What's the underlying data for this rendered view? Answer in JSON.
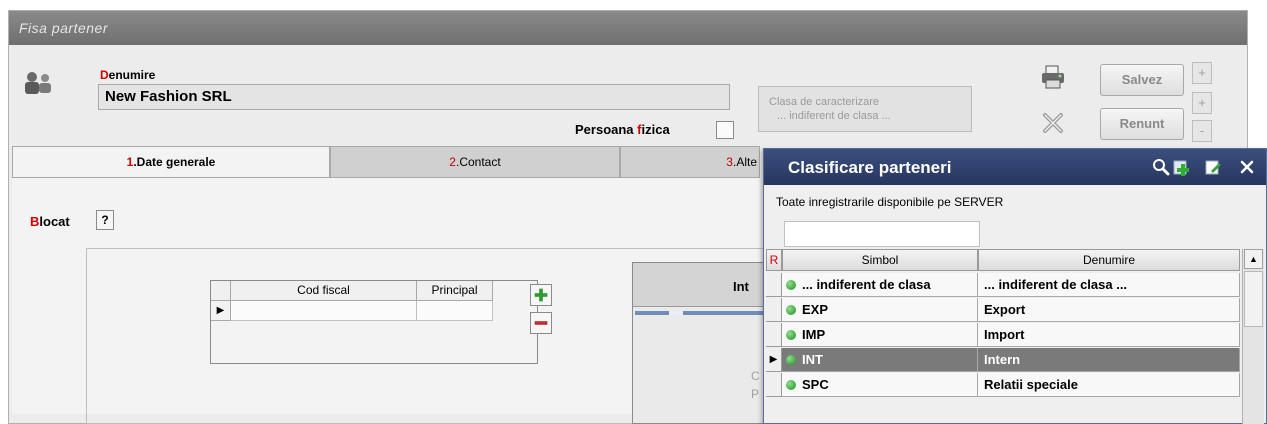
{
  "window": {
    "title": "Fisa partener"
  },
  "header": {
    "denumire_accent": "D",
    "denumire_rest": "enumire",
    "denumire_value": "New Fashion SRL",
    "pf_prefix": "Persoana ",
    "pf_accent": "f",
    "pf_suffix": "izica",
    "clasa_line1": "Clasa de caracterizare",
    "clasa_line2": "... indiferent de clasa ..."
  },
  "actions": {
    "save": "Salvez",
    "cancel": "Renunt",
    "nav_up": "+",
    "nav_mid": "+",
    "nav_down": "-"
  },
  "tabs": [
    {
      "accent": "1",
      "label": ".Date generale"
    },
    {
      "accent": "2",
      "label": ".Contact"
    },
    {
      "accent": "3",
      "label": ".Alte"
    }
  ],
  "general": {
    "blocat_accent": "B",
    "blocat_rest": "locat",
    "blocat_btn": "?",
    "grid_headers": [
      "Cod fiscal",
      "Principal"
    ],
    "row_indicator": "▶",
    "inner_title": "Int",
    "inner_t1": "C",
    "inner_t2": "P"
  },
  "popup": {
    "title": "Clasificare parteneri",
    "subtitle": "Toate inregistrarile disponibile pe SERVER",
    "search_value": "",
    "r_marker": "R",
    "columns": [
      "Simbol",
      "Denumire"
    ],
    "selected_indicator": "▶",
    "scroll_up": "▲",
    "rows": [
      {
        "simbol": "... indiferent de clasa",
        "denumire": "... indiferent de clasa ..."
      },
      {
        "simbol": "EXP",
        "denumire": "Export"
      },
      {
        "simbol": "IMP",
        "denumire": "Import"
      },
      {
        "simbol": "INT",
        "denumire": "Intern"
      },
      {
        "simbol": "SPC",
        "denumire": "Relatii speciale"
      }
    ]
  },
  "colors": {
    "accent_red": "#d40000",
    "popup_title_bg": "#2f4272",
    "selected_row_bg": "#7a7a7a",
    "status_dot": "#2ea32e"
  },
  "icons": [
    "partner-icon",
    "printer-icon",
    "cancel-x-icon",
    "search-icon",
    "add-icon",
    "edit-icon",
    "close-icon",
    "plus-icon",
    "minus-icon"
  ]
}
